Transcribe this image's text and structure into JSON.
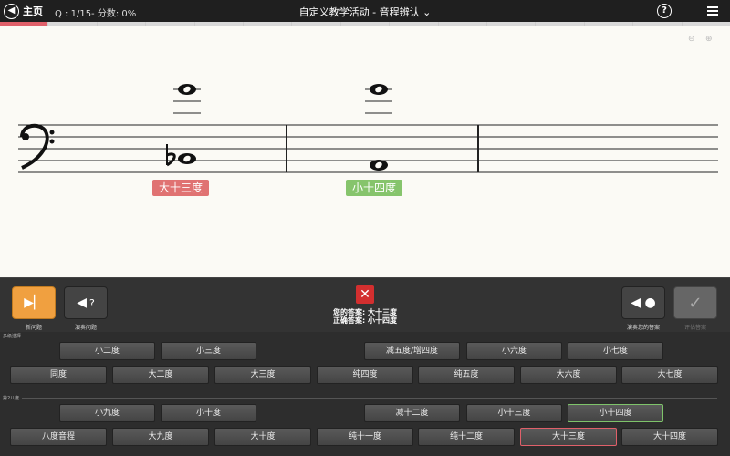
{
  "topbar": {
    "home_label": "主页",
    "home_icon": "back-arrow-icon",
    "progress": "Q : 1/15- 分数: 0%",
    "title": "自定义教学活动 - 音程辨认 ⌄",
    "help_glyph": "?"
  },
  "progress_strip": {
    "total_segments": 15,
    "done_segments": 1,
    "done_color": "#e0606a"
  },
  "score": {
    "clef": "bass",
    "your_label": "大十三度",
    "correct_label": "小十四度",
    "your_label_color": "#e07272",
    "correct_label_color": "#86c46c"
  },
  "controls": {
    "next_label": "新问题",
    "replay_label": "演奏问题",
    "replay_glyph": "?",
    "play_answer_label": "演奏您的答案",
    "submit_label": "评估答案"
  },
  "result": {
    "icon": "x-icon",
    "your_answer": "您的答案: 大十三度",
    "correct_answer": "正确答案: 小十四度"
  },
  "sections": {
    "simple_label": "多级选择",
    "compound_label": "第2八度"
  },
  "simple_row1": [
    "小二度",
    "小三度",
    "减五度/增四度",
    "小六度",
    "小七度"
  ],
  "simple_row2": [
    "同度",
    "大二度",
    "大三度",
    "纯四度",
    "纯五度",
    "大六度",
    "大七度"
  ],
  "compound_row1": [
    "小九度",
    "小十度",
    "减十二度",
    "小十三度",
    "小十四度"
  ],
  "compound_row2": [
    "八度音程",
    "大九度",
    "大十度",
    "纯十一度",
    "纯十二度",
    "大十三度",
    "大十四度"
  ]
}
